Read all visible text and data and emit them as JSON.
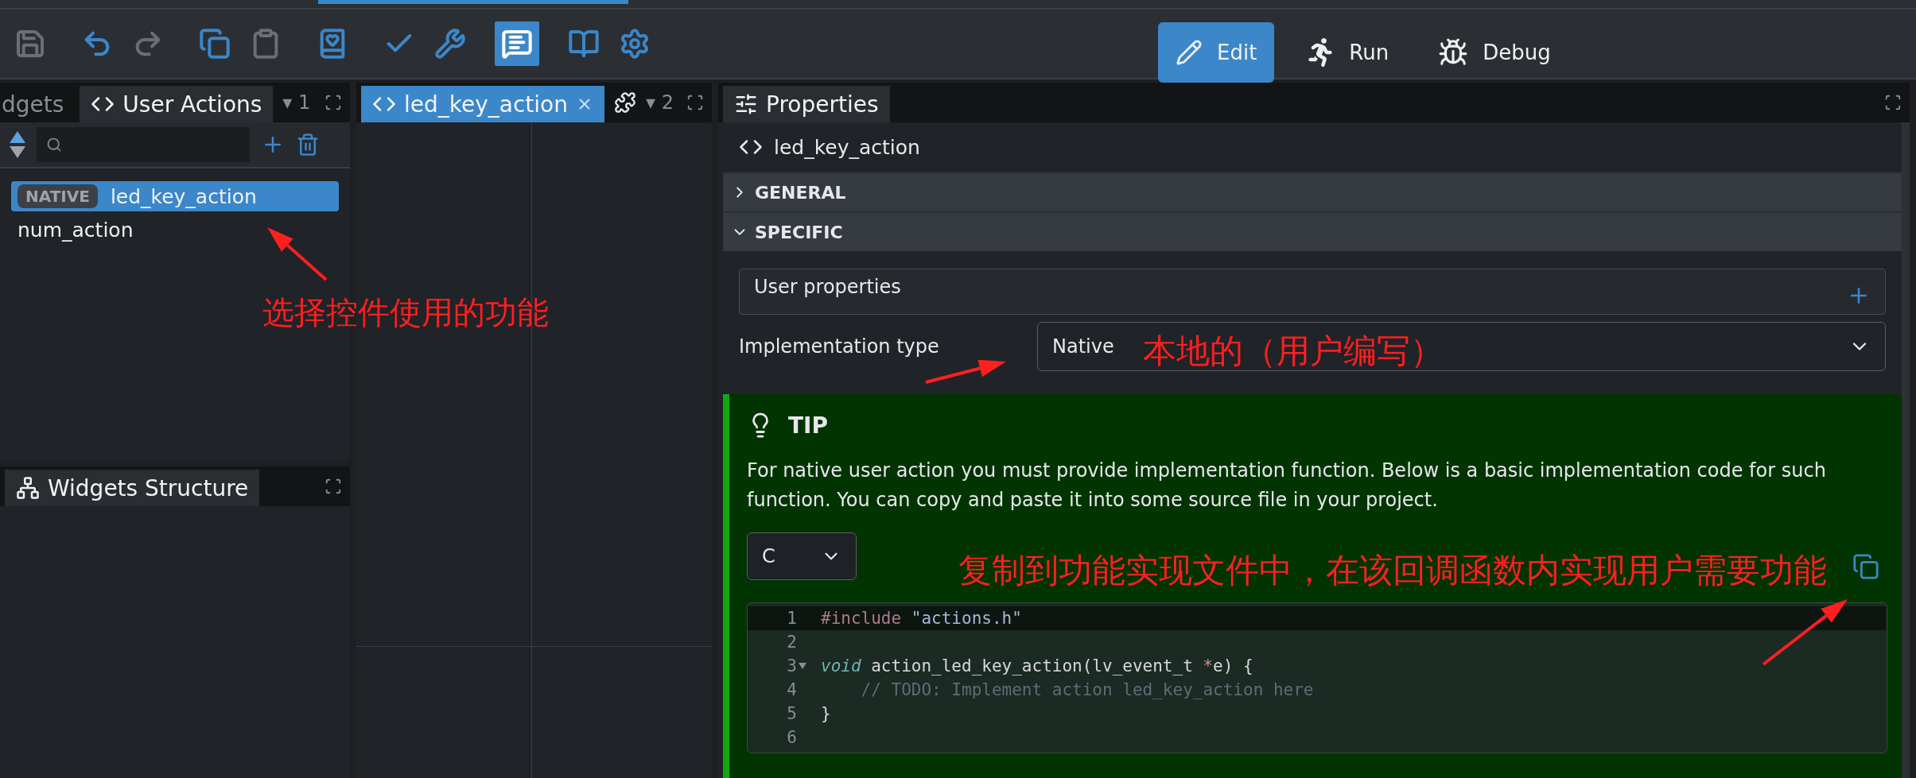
{
  "toolbar": {
    "groups": [
      [
        {
          "kind": "save",
          "disabled": true,
          "on": false
        }
      ],
      [
        {
          "kind": "undo",
          "disabled": false,
          "on": false
        },
        {
          "kind": "redo",
          "disabled": true,
          "on": false
        }
      ],
      [
        {
          "kind": "copy",
          "disabled": false,
          "on": false
        },
        {
          "kind": "paste",
          "disabled": true,
          "on": false
        }
      ],
      [
        {
          "kind": "notebook",
          "disabled": false,
          "on": false
        }
      ],
      [
        {
          "kind": "check",
          "disabled": false,
          "on": false
        },
        {
          "kind": "wrench",
          "disabled": false,
          "on": false
        }
      ],
      [
        {
          "kind": "message",
          "disabled": false,
          "on": true
        }
      ],
      [
        {
          "kind": "book",
          "disabled": false,
          "on": false
        },
        {
          "kind": "settings",
          "disabled": false,
          "on": false
        }
      ]
    ],
    "modes": [
      {
        "kind": "edit",
        "label": "Edit",
        "selected": true
      },
      {
        "kind": "run",
        "label": "Run",
        "selected": false
      },
      {
        "kind": "debug",
        "label": "Debug",
        "selected": false
      }
    ]
  },
  "left_panel": {
    "tabs": [
      {
        "label": "dgets",
        "selected": false
      },
      {
        "label": "User Actions",
        "selected": true
      }
    ],
    "tab_menu": "▾",
    "tab_count": "1",
    "actions": [
      {
        "badge": "NATIVE",
        "name": "led_key_action",
        "selected": true
      },
      {
        "name": "num_action",
        "selected": false
      }
    ]
  },
  "structure_panel": {
    "title": "Widgets Structure"
  },
  "editor_panel": {
    "tabs": [
      {
        "label": "led_key_action",
        "selected": true
      }
    ],
    "tab_menu": "▾",
    "tab_count": "2"
  },
  "properties": {
    "tab": "Properties",
    "object_name": "led_key_action",
    "sections": [
      {
        "title": "GENERAL",
        "expanded": false
      },
      {
        "title": "SPECIFIC",
        "expanded": true
      }
    ],
    "user_properties": "User properties",
    "implementation_label": "Implementation type",
    "implementation_value": "Native",
    "tip": {
      "title": "TIP",
      "text": "For native user action you must provide implementation function. Below is a basic implementation code for such function. You can copy and paste it into some source file in your project.",
      "language": "C",
      "code": [
        {
          "number": "1",
          "active": true,
          "foldable": false,
          "tokens": [
            {
              "kind": "directive",
              "text": "#include "
            },
            {
              "kind": "string",
              "text": "\"actions.h\""
            }
          ]
        },
        {
          "number": "2",
          "active": false,
          "foldable": false
        },
        {
          "number": "3",
          "active": false,
          "foldable": true,
          "tokens": [
            {
              "kind": "keyword",
              "text": "void"
            },
            {
              "kind": "plain",
              "text": " action_led_key_action(lv_event_t "
            },
            {
              "kind": "operator",
              "text": "*"
            },
            {
              "kind": "plain",
              "text": "e) {"
            }
          ]
        },
        {
          "number": "4",
          "active": false,
          "foldable": false,
          "tokens": [
            {
              "kind": "comment",
              "text": "    // TODO: Implement action led_key_action here"
            }
          ]
        },
        {
          "number": "5",
          "active": false,
          "foldable": false,
          "tokens": [
            {
              "kind": "plain",
              "text": "}"
            }
          ]
        },
        {
          "number": "6",
          "active": false,
          "foldable": false
        }
      ]
    }
  },
  "annotations": [
    {
      "text": "选择控件使用的功能"
    },
    {
      "text": "本地的（用户编写）"
    },
    {
      "text": "复制到功能实现文件中，在该回调函数内实现用户需要功能"
    }
  ]
}
